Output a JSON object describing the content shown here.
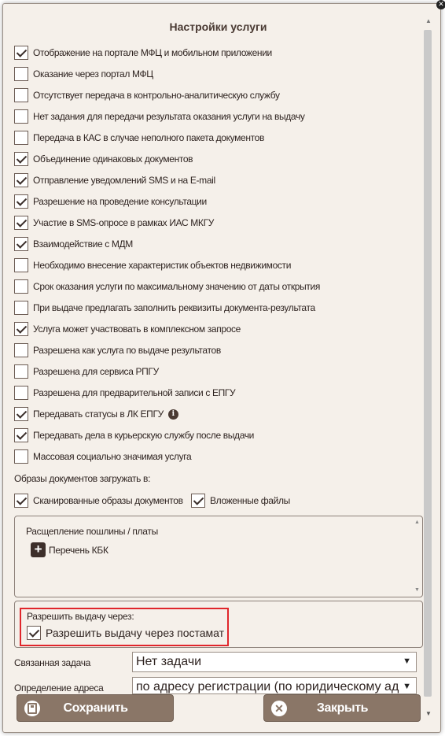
{
  "dialog": {
    "title": "Настройки услуги",
    "close_icon": "close-icon"
  },
  "options": [
    {
      "label": "Отображение на портале МФЦ и мобильном приложении",
      "checked": true
    },
    {
      "label": "Оказание через портал МФЦ",
      "checked": false
    },
    {
      "label": "Отсутствует передача в контрольно-аналитическую службу",
      "checked": false
    },
    {
      "label": "Нет задания для передачи результата оказания услуги на выдачу",
      "checked": false
    },
    {
      "label": "Передача в КАС в случае неполного пакета документов",
      "checked": false
    },
    {
      "label": "Объединение одинаковых документов",
      "checked": true
    },
    {
      "label": "Отправление уведомлений SMS и на E-mail",
      "checked": true
    },
    {
      "label": "Разрешение на проведение консультации",
      "checked": true
    },
    {
      "label": "Участие в SMS-опросе в рамках ИАС МКГУ",
      "checked": true
    },
    {
      "label": "Взаимодействие с МДМ",
      "checked": true
    },
    {
      "label": "Необходимо внесение характеристик объектов недвижимости",
      "checked": false
    },
    {
      "label": "Срок оказания услуги по максимальному значению от даты открытия",
      "checked": false
    },
    {
      "label": "При выдаче предлагать заполнить реквизиты документа-результата",
      "checked": false
    },
    {
      "label": "Услуга может участвовать в комплексном запросе",
      "checked": true
    },
    {
      "label": "Разрешена как услуга по выдаче результатов",
      "checked": false
    },
    {
      "label": "Разрешена для сервиса РПГУ",
      "checked": false
    },
    {
      "label": "Разрешена для предварительной записи с ЕПГУ",
      "checked": false
    },
    {
      "label": "Передавать статусы в ЛК ЕПГУ",
      "checked": true,
      "info_icon": "info-icon"
    },
    {
      "label": "Передавать дела в курьерскую службу после выдачи",
      "checked": true
    },
    {
      "label": "Массовая социально значимая услуга",
      "checked": false
    }
  ],
  "upload": {
    "label": "Образы документов загружать в:",
    "scanned": {
      "label": "Сканированные образы документов",
      "checked": true
    },
    "attached": {
      "label": "Вложенные файлы",
      "checked": true
    }
  },
  "fees": {
    "title": "Расщепление пошлины / платы",
    "add_label": "Перечень КБК",
    "add_icon": "plus-icon"
  },
  "issue": {
    "title": "Разрешить выдачу через:",
    "option": {
      "label": "Разрешить выдачу через постамат",
      "checked": true
    },
    "highlight_color": "#e0262b"
  },
  "fields": {
    "related_task": {
      "label": "Связанная задача",
      "value": "Нет задачи"
    },
    "address": {
      "label": "Определение адреса",
      "value": "по адресу регистрации (по юридическому ад"
    }
  },
  "buttons": {
    "save": {
      "label": "Сохранить",
      "icon": "floppy-disk-icon"
    },
    "close": {
      "label": "Закрыть",
      "icon": "close-circle-icon"
    }
  },
  "colors": {
    "background": "#f5f0ea",
    "button": "#8a7667",
    "text": "#2e2320"
  }
}
